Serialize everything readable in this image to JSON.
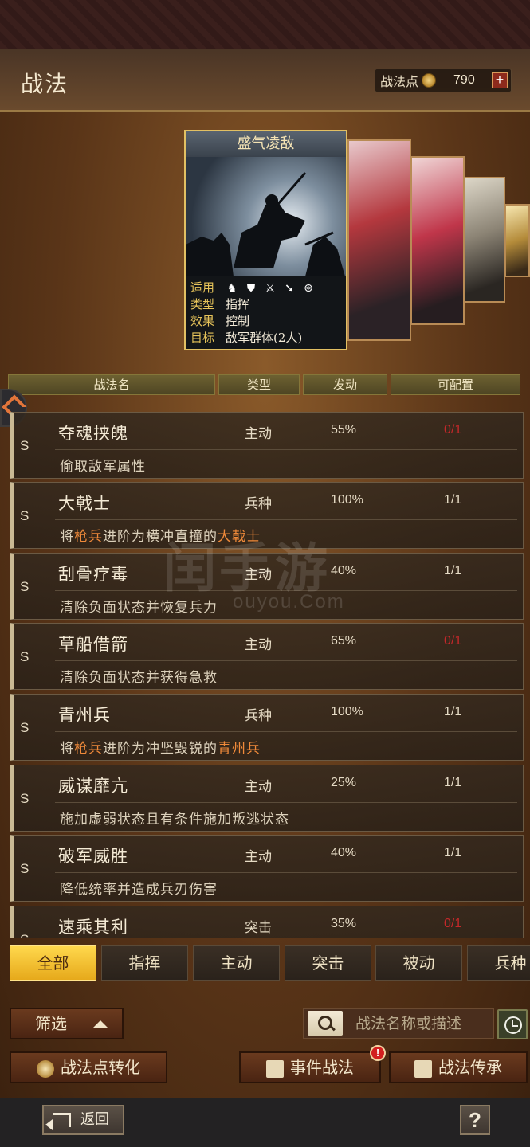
{
  "header": {
    "title": "战法",
    "points_label": "战法点",
    "points_value": "790",
    "plus_label": "+"
  },
  "featured_card": {
    "title": "盛气凌敌",
    "applicable_label": "适用",
    "type_label": "类型",
    "type_value": "指挥",
    "effect_label": "效果",
    "effect_value": "控制",
    "target_label": "目标",
    "target_value": "敌军群体(2人)",
    "troop_icons": [
      "cavalry-icon",
      "shield-icon",
      "crossed-swords-icon",
      "arrow-icon",
      "wheel-icon"
    ]
  },
  "table_headers": {
    "name": "战法名",
    "type": "类型",
    "activation": "发动",
    "configurable": "可配置"
  },
  "tactics": [
    {
      "grade": "S",
      "name": "夺魂挟魄",
      "type": "主动",
      "rate": "55%",
      "config": "0/1",
      "config_red": true,
      "desc": "偷取敌军属性"
    },
    {
      "grade": "S",
      "name": "大戟士",
      "type": "兵种",
      "rate": "100%",
      "config": "1/1",
      "config_red": false,
      "desc_a": "将",
      "desc_hl1": "枪兵",
      "desc_b": "进阶为横冲直撞的",
      "desc_hl2": "大戟士"
    },
    {
      "grade": "S",
      "name": "刮骨疗毒",
      "type": "主动",
      "rate": "40%",
      "config": "1/1",
      "config_red": false,
      "desc": "清除负面状态并恢复兵力"
    },
    {
      "grade": "S",
      "name": "草船借箭",
      "type": "主动",
      "rate": "65%",
      "config": "0/1",
      "config_red": true,
      "desc": "清除负面状态并获得急救"
    },
    {
      "grade": "S",
      "name": "青州兵",
      "type": "兵种",
      "rate": "100%",
      "config": "1/1",
      "config_red": false,
      "desc_a": "将",
      "desc_hl1": "枪兵",
      "desc_b": "进阶为冲坚毁锐的",
      "desc_hl2": "青州兵"
    },
    {
      "grade": "S",
      "name": "威谋靡亢",
      "type": "主动",
      "rate": "25%",
      "config": "1/1",
      "config_red": false,
      "desc": "施加虚弱状态且有条件施加叛逃状态"
    },
    {
      "grade": "S",
      "name": "破军威胜",
      "type": "主动",
      "rate": "40%",
      "config": "1/1",
      "config_red": false,
      "desc": "降低统率并造成兵刃伤害"
    },
    {
      "grade": "S",
      "name": "速乘其利",
      "type": "突击",
      "rate": "35%",
      "config": "0/1",
      "config_red": true,
      "desc": ""
    }
  ],
  "watermark": {
    "main": "闰手游",
    "sub": "ouyou.Com"
  },
  "category_tabs": [
    "全部",
    "指挥",
    "主动",
    "突击",
    "被动",
    "兵种"
  ],
  "controls": {
    "filter_label": "筛选",
    "search_placeholder": "战法名称或描述",
    "convert_label": "战法点转化",
    "event_label": "事件战法",
    "event_badge": "!",
    "inherit_label": "战法传承",
    "back_label": "返回",
    "help_label": "?"
  }
}
